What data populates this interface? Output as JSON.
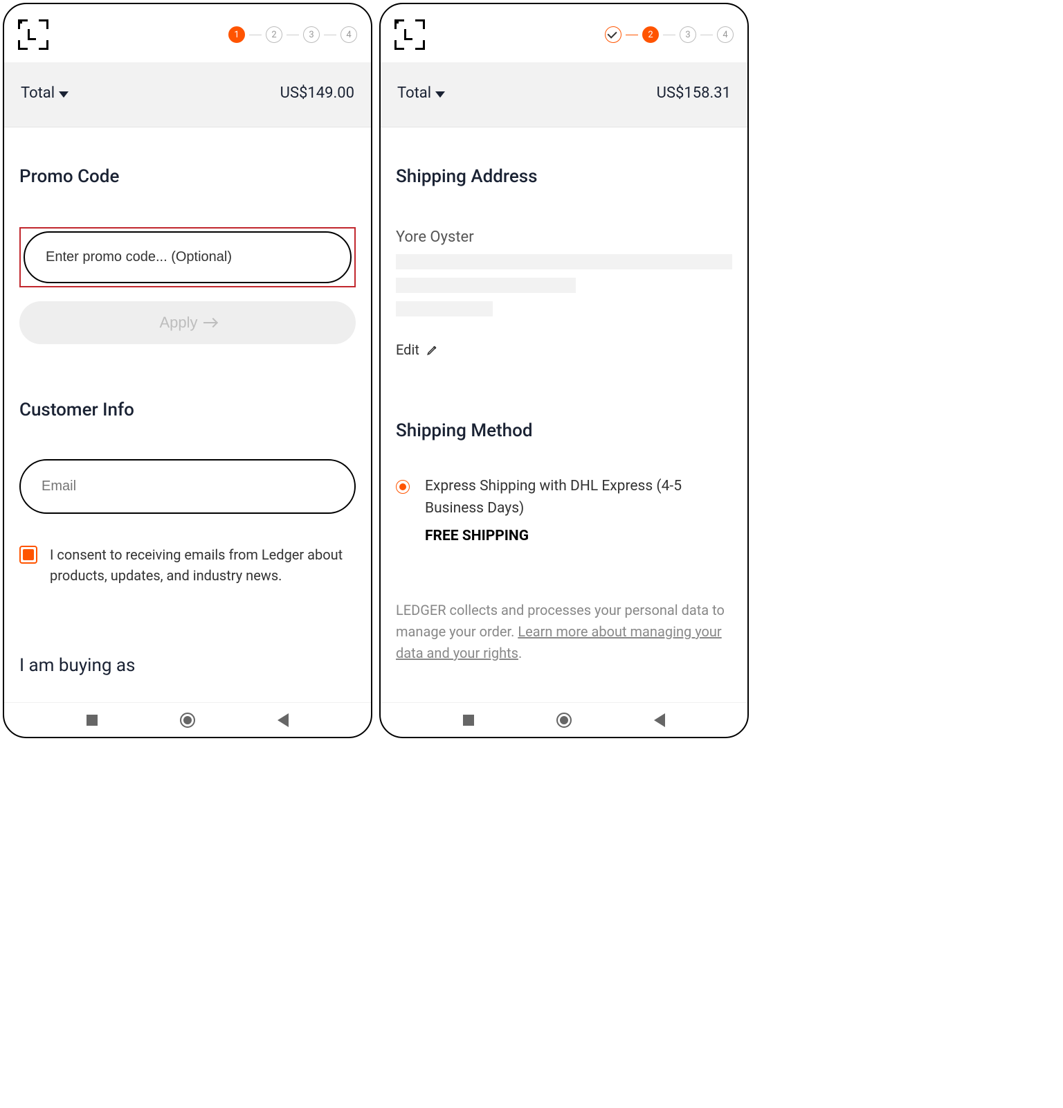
{
  "left": {
    "steps": [
      "1",
      "2",
      "3",
      "4"
    ],
    "total_label": "Total",
    "total_value": "US$149.00",
    "promo_title": "Promo Code",
    "promo_placeholder": "Enter promo code... (Optional)",
    "apply_label": "Apply",
    "customer_title": "Customer Info",
    "email_label": "Email",
    "consent_label": "I consent to receiving emails from Ledger about products, updates, and industry news.",
    "buying_as_title": "I am buying as"
  },
  "right": {
    "steps": [
      "✓",
      "2",
      "3",
      "4"
    ],
    "total_label": "Total",
    "total_value": "US$158.31",
    "shipping_addr_title": "Shipping Address",
    "name": "Yore Oyster",
    "edit_label": "Edit",
    "shipping_method_title": "Shipping Method",
    "shipping_option": "Express Shipping with DHL Express (4-5 Business Days)",
    "free_shipping": "FREE SHIPPING",
    "privacy_prefix": "LEDGER collects and processes your personal data to manage your order. ",
    "privacy_link": "Learn more about managing your data and your rights",
    "privacy_suffix": "."
  }
}
